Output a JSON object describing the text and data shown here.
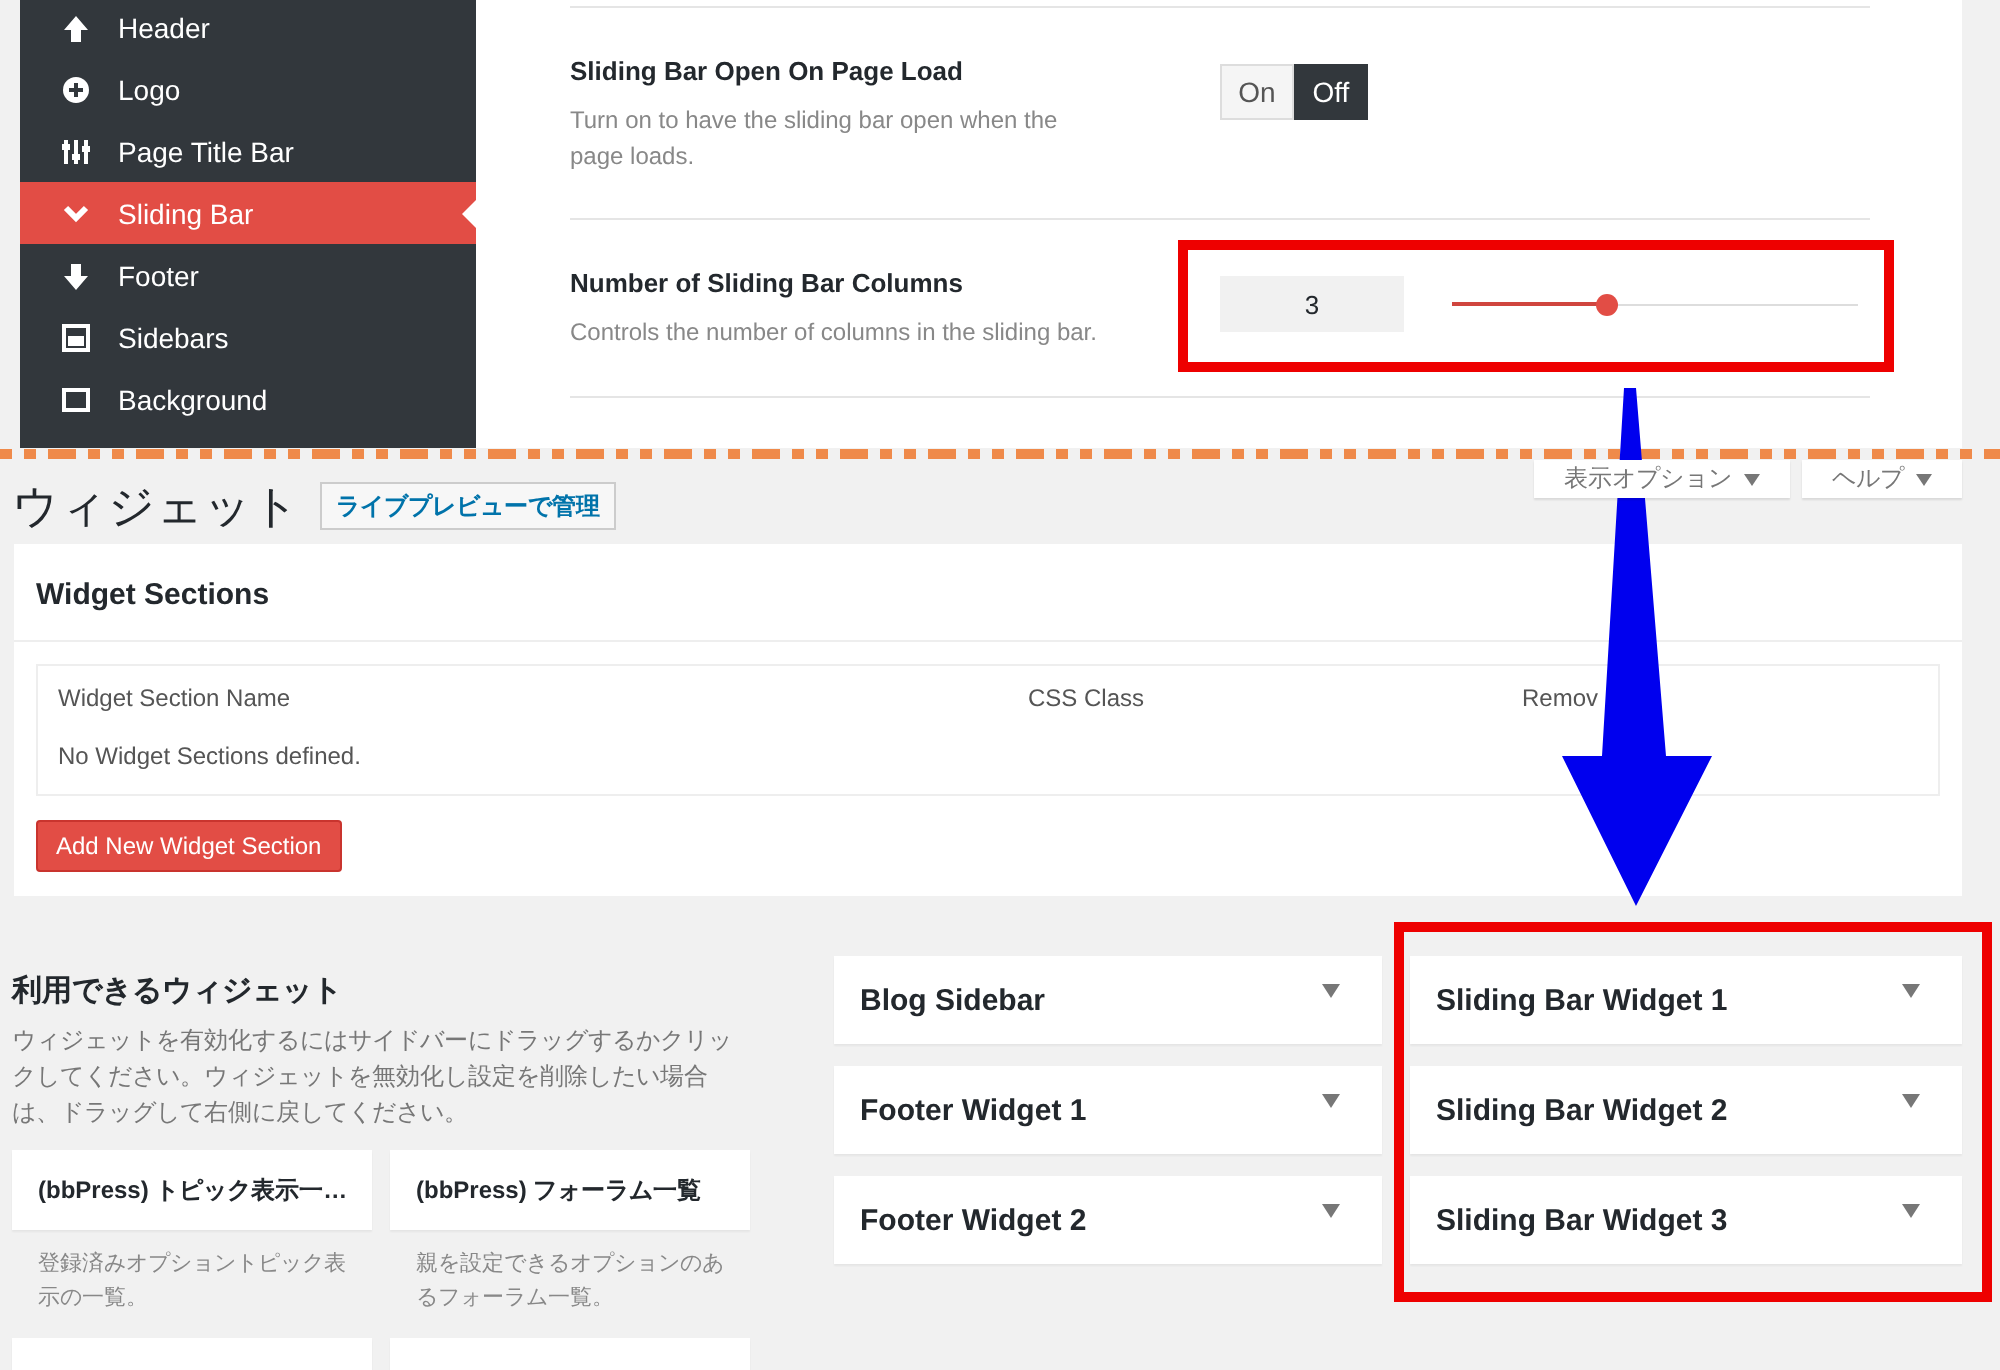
{
  "theme_options": {
    "menu": [
      {
        "label": "Header",
        "selected": false
      },
      {
        "label": "Logo",
        "selected": false
      },
      {
        "label": "Page Title Bar",
        "selected": false
      },
      {
        "label": "Sliding Bar",
        "selected": true
      },
      {
        "label": "Footer",
        "selected": false
      },
      {
        "label": "Sidebars",
        "selected": false
      },
      {
        "label": "Background",
        "selected": false
      }
    ],
    "settings": [
      {
        "kind": "toggle",
        "title": "Sliding Bar Open On Page Load",
        "description": "Turn on to have the sliding bar open when the page loads.",
        "options": [
          {
            "label": "On",
            "selected": false
          },
          {
            "label": "Off",
            "selected": true
          }
        ]
      },
      {
        "kind": "slider",
        "title": "Number of Sliding Bar Columns",
        "description": "Controls the number of columns in the sliding bar.",
        "value": "3",
        "level": 0.38
      }
    ]
  },
  "widgets_page": {
    "title": "ウィジェット",
    "live_preview_button": "ライブプレビューで管理",
    "header_tabs": [
      {
        "label": "表示オプション"
      },
      {
        "label": "ヘルプ"
      }
    ],
    "widget_sections": {
      "title": "Widget Sections",
      "columns": [
        "Widget Section Name",
        "CSS Class",
        "Remov"
      ],
      "empty_message": "No Widget Sections defined.",
      "add_button": "Add New Widget Section"
    },
    "available_widgets": {
      "title": "利用できるウィジェット",
      "description": "ウィジェットを有効化するにはサイドバーにドラッグするかクリックしてください。ウィジェットを無効化し設定を削除したい場合は、ドラッグして右側に戻してください。",
      "widgets": [
        {
          "name": "(bbPress) トピック表示一…",
          "description": "登録済みオプショントピック表示の一覧。"
        },
        {
          "name": "(bbPress) フォーラム一覧",
          "description": "親を設定できるオプションのあるフォーラム一覧。"
        }
      ]
    },
    "sidebar_columns": [
      [
        "Blog Sidebar",
        "Footer Widget 1",
        "Footer Widget 2"
      ],
      [
        "Sliding Bar Widget 1",
        "Sliding Bar Widget 2",
        "Sliding Bar Widget 3"
      ]
    ]
  }
}
